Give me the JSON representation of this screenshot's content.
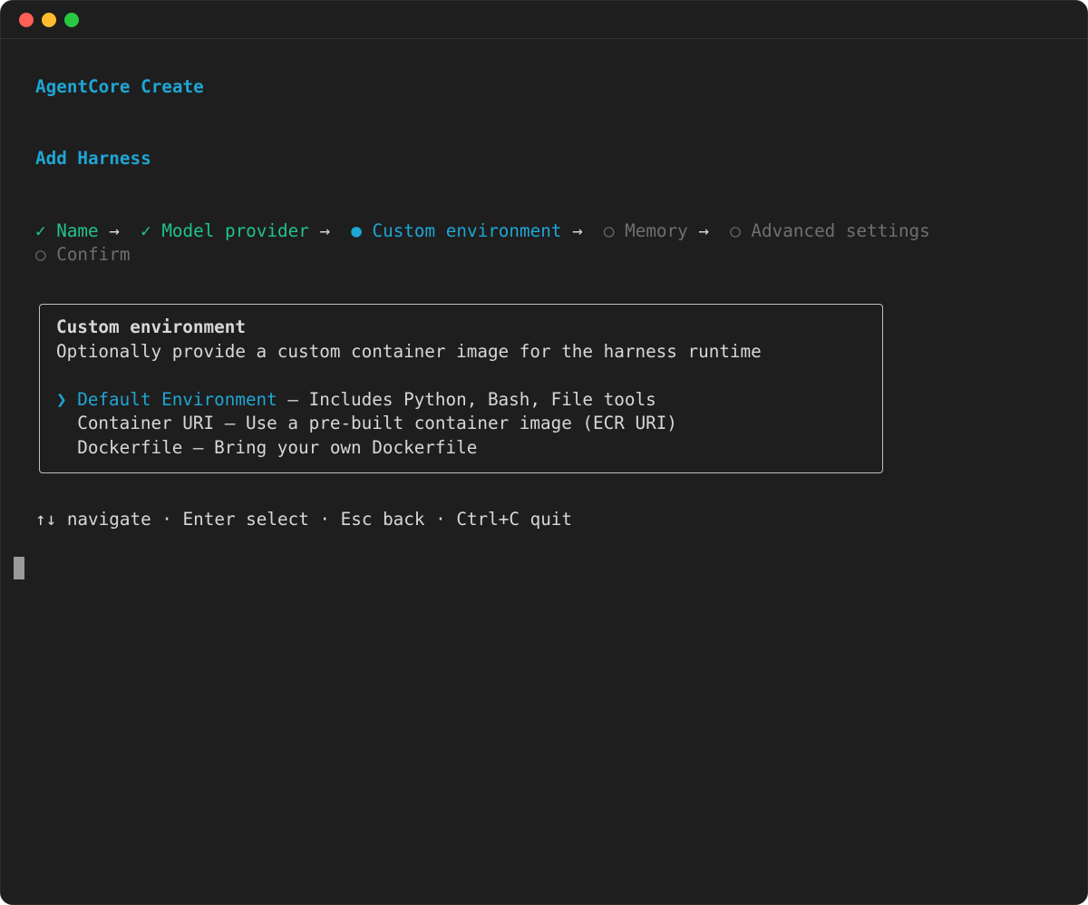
{
  "window": {
    "controls": [
      "close-dot",
      "minimize-dot",
      "maximize-dot"
    ],
    "colors": {
      "close": "#ff5f57",
      "minimize": "#febc2e",
      "maximize": "#28c840"
    }
  },
  "app_title": "AgentCore Create",
  "page_title": "Add Harness",
  "steps": [
    {
      "icon": "✓",
      "label": "Name",
      "state": "done"
    },
    {
      "icon": "✓",
      "label": "Model provider",
      "state": "done"
    },
    {
      "icon": "●",
      "label": "Custom environment",
      "state": "current"
    },
    {
      "icon": "○",
      "label": "Memory",
      "state": "pending"
    },
    {
      "icon": "○",
      "label": "Advanced settings",
      "state": "pending"
    },
    {
      "icon": "○",
      "label": "Confirm",
      "state": "pending"
    }
  ],
  "step_separator": "→",
  "panel": {
    "title": "Custom environment",
    "description": "Optionally provide a custom container image for the harness runtime",
    "pointer": "❯",
    "options": [
      {
        "label": "Default Environment",
        "description": " – Includes Python, Bash, File tools",
        "selected": true
      },
      {
        "label": "Container URI",
        "description": " – Use a pre-built container image (ECR URI)",
        "selected": false
      },
      {
        "label": "Dockerfile",
        "description": " – Bring your own Dockerfile",
        "selected": false
      }
    ]
  },
  "help_text": "↑↓ navigate · Enter select · Esc back · Ctrl+C quit",
  "colors": {
    "accent": "#1ea6d4",
    "done": "#21c28c",
    "pending": "#6f6f6f",
    "text": "#d7d7d7",
    "background": "#1e1e1e"
  }
}
